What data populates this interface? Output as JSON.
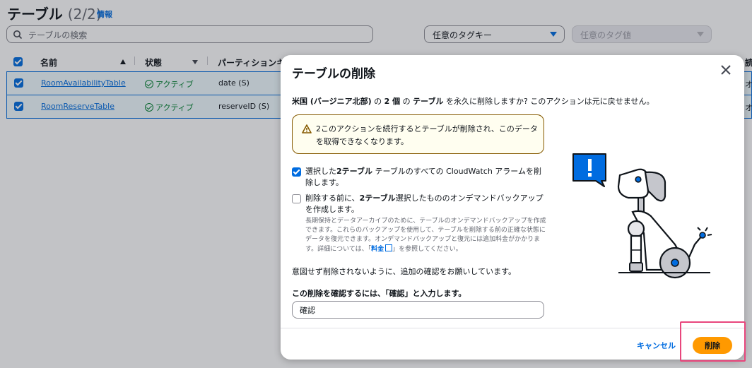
{
  "page": {
    "title": "テーブル",
    "count": "(2/2)",
    "info": "情報",
    "search_placeholder": "テーブルの検索",
    "tag_key": "任意のタグキー",
    "tag_value": "任意のタグ値"
  },
  "table": {
    "headers": {
      "name": "名前",
      "status": "状態",
      "partition": "パーティションキ"
    },
    "rows": [
      {
        "name": "RoomAvailabilityTable",
        "status": "アクティブ",
        "partition": "date (S)",
        "edge": "オ"
      },
      {
        "name": "RoomReserveTable",
        "status": "アクティブ",
        "partition": "reserveID (S)",
        "edge": "オ"
      }
    ],
    "edge_header": "読"
  },
  "modal": {
    "title": "テーブルの削除",
    "desc_region": "米国 (バージニア北部)",
    "desc_mid1": " の ",
    "desc_count": "2 個",
    "desc_mid2": " の ",
    "desc_tables": "テーブル",
    "desc_tail": " を永久に削除しますか? このアクションは元に戻せません。",
    "alert": "2このアクションを続行するとテーブルが削除され、このデータを取得できなくなります。",
    "opt1_pre": "選択した",
    "opt1_bold": "2テーブル",
    "opt1_post": " テーブルのすべての CloudWatch アラームを削除します。",
    "opt2_pre": "削除する前に、",
    "opt2_bold": "2テーブル",
    "opt2_post": "選択したもののオンデマンドバックアップを作成します。",
    "opt2_help": "長期保持とデータアーカイブのために、テーブルのオンデマンドバックアップを作成できます。これらのバックアップを使用して、テーブルを削除する前の正確な状態にデータを復元できます。オンデマンドバックアップと復元には追加料金がかかります。詳細については、「",
    "opt2_link": "料金",
    "opt2_help_end": "」を参照してください。",
    "note": "意図せず削除されないように、追加の確認をお願いしています。",
    "confirm_label": "この削除を確認するには、「確認」と入力します。",
    "confirm_value": "確認",
    "cancel": "キャンセル",
    "delete": "削除"
  },
  "colors": {
    "accent": "#006ce0",
    "primary_button": "#ff9900",
    "highlight": "#e8467c",
    "success": "#00802f"
  }
}
